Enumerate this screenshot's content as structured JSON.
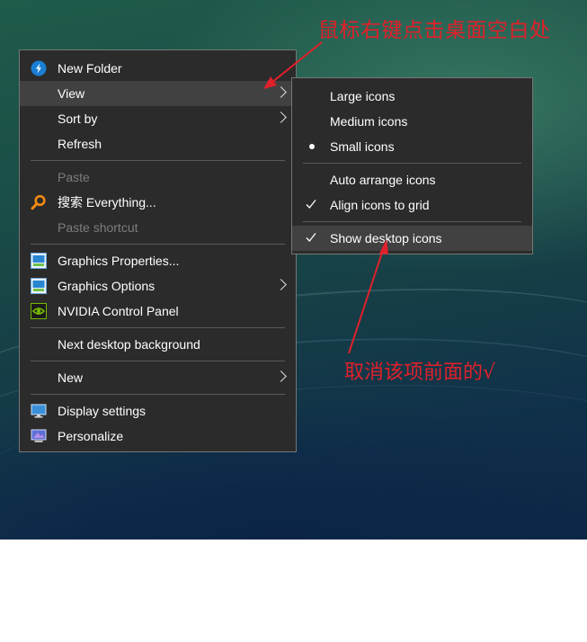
{
  "main_menu": {
    "items": [
      {
        "label": "New Folder",
        "icon": "pin-icon"
      },
      {
        "label": "View",
        "submenu": true
      },
      {
        "label": "Sort by",
        "submenu": true
      },
      {
        "label": "Refresh"
      },
      {
        "label": "Paste",
        "disabled": true
      },
      {
        "label": "搜索 Everything...",
        "icon": "search-icon"
      },
      {
        "label": "Paste shortcut",
        "disabled": true
      },
      {
        "label": "Graphics Properties...",
        "icon": "intel-graphics-icon"
      },
      {
        "label": "Graphics Options",
        "icon": "intel-graphics-icon",
        "submenu": true
      },
      {
        "label": "NVIDIA Control Panel",
        "icon": "nvidia-icon"
      },
      {
        "label": "Next desktop background"
      },
      {
        "label": "New",
        "submenu": true
      },
      {
        "label": "Display settings",
        "icon": "display-icon"
      },
      {
        "label": "Personalize",
        "icon": "personalize-icon"
      }
    ]
  },
  "view_submenu": {
    "items": [
      {
        "label": "Large icons"
      },
      {
        "label": "Medium icons"
      },
      {
        "label": "Small icons",
        "selected": true
      },
      {
        "label": "Auto arrange icons"
      },
      {
        "label": "Align icons to grid",
        "checked": true
      },
      {
        "label": "Show desktop icons",
        "checked": true
      }
    ]
  },
  "annotations": {
    "top": "鼠标右键点击桌面空白处",
    "bottom": "取消该项前面的√"
  },
  "colors": {
    "annotation": "#e0202a",
    "menu_bg": "#2b2b2b",
    "menu_highlight": "#414141"
  }
}
